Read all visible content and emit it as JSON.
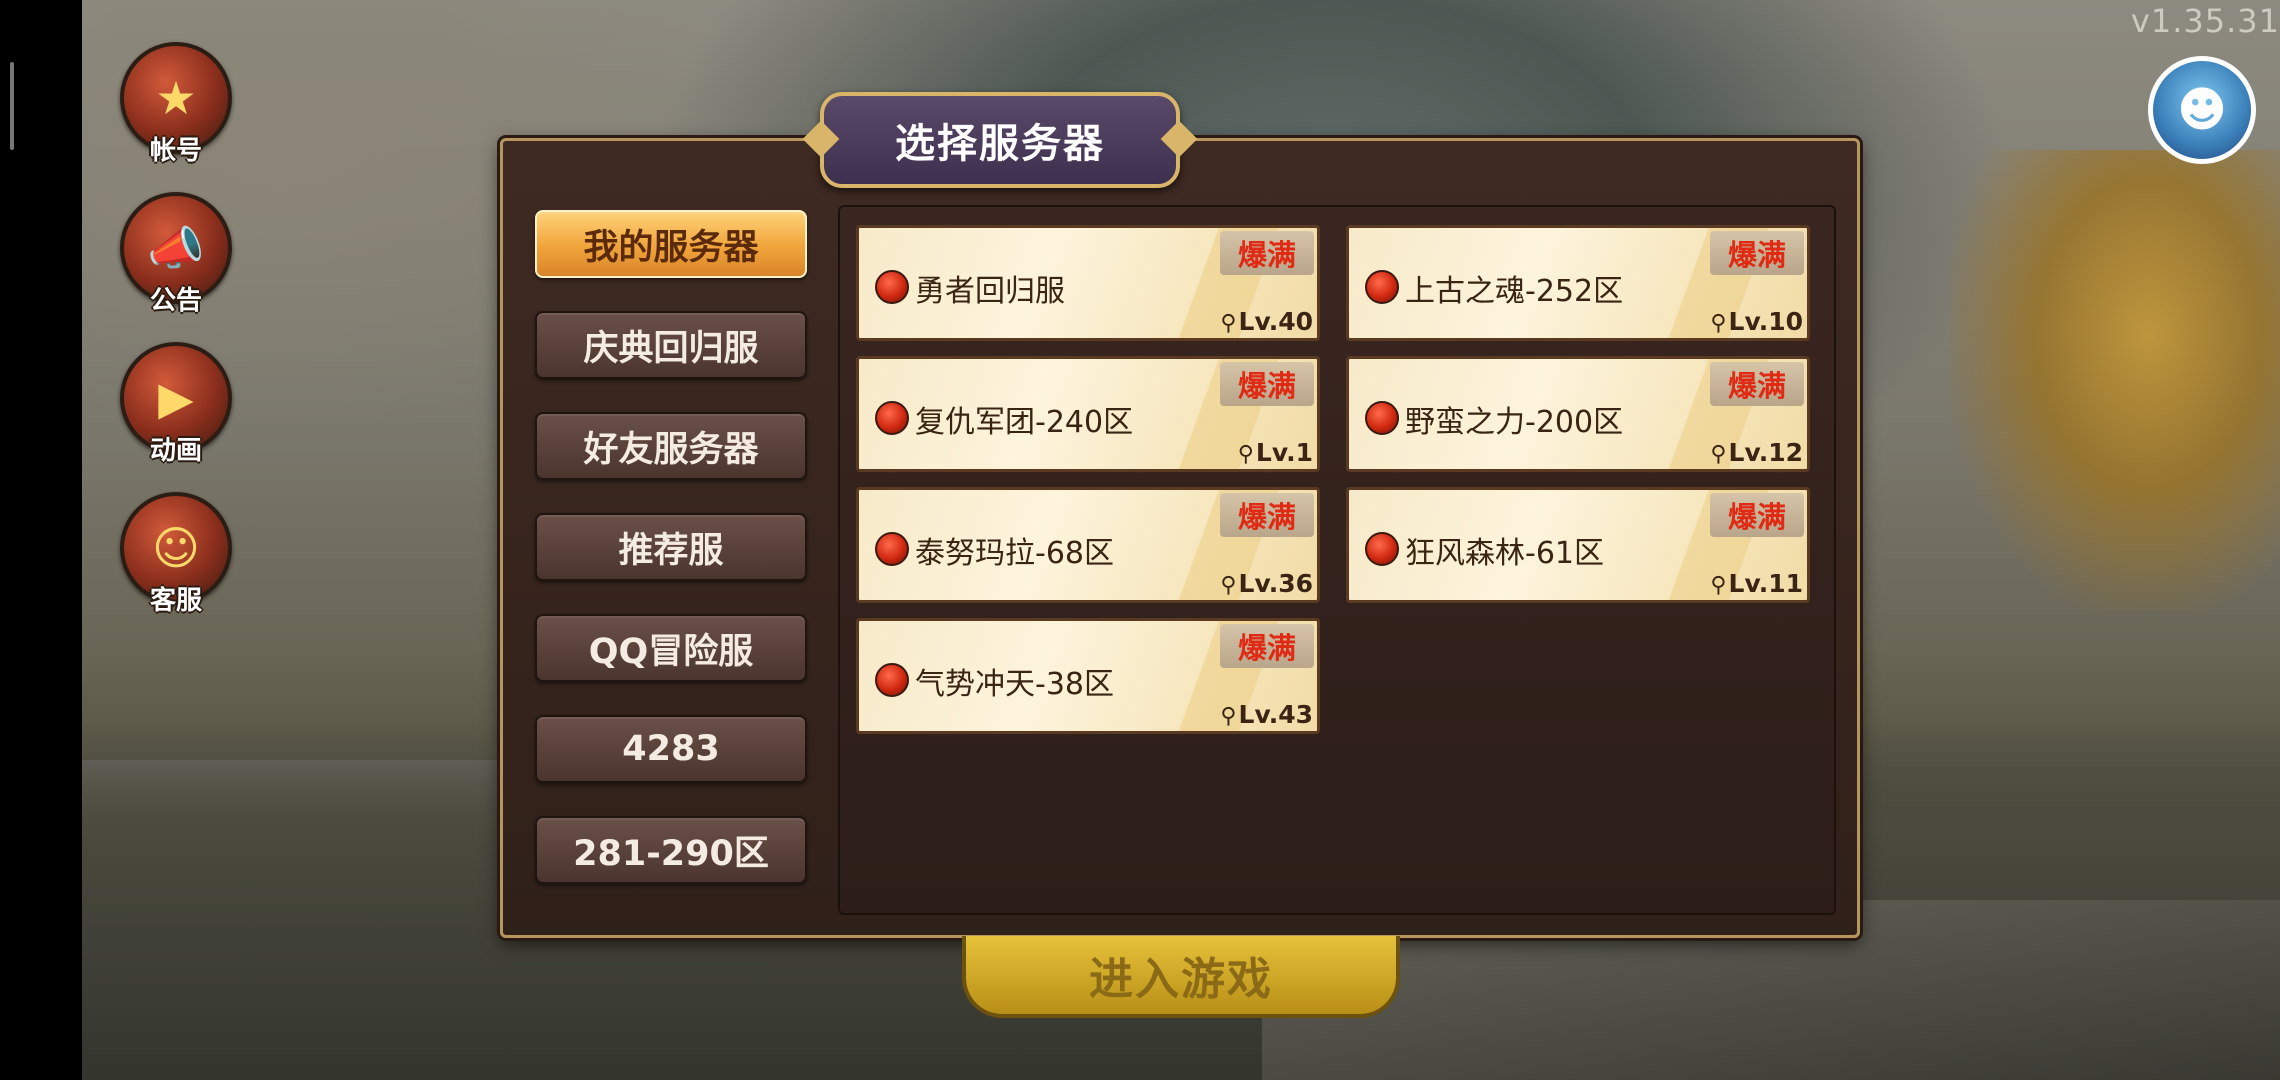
{
  "version": "v1.35.31",
  "side_buttons": [
    {
      "label": "帐号",
      "icon": "book-icon"
    },
    {
      "label": "公告",
      "icon": "megaphone-icon"
    },
    {
      "label": "动画",
      "icon": "video-icon"
    },
    {
      "label": "客服",
      "icon": "customer-service-icon"
    }
  ],
  "dialog": {
    "title": "选择服务器",
    "tabs": [
      {
        "label": "我的服务器",
        "active": true
      },
      {
        "label": "庆典回归服",
        "active": false
      },
      {
        "label": "好友服务器",
        "active": false
      },
      {
        "label": "推荐服",
        "active": false
      },
      {
        "label": "QQ冒险服",
        "active": false
      },
      {
        "label": "4283",
        "active": false
      },
      {
        "label": "281-290区",
        "active": false
      }
    ],
    "servers": [
      {
        "name": "勇者回归服",
        "status": "爆满",
        "level": "Lv.40"
      },
      {
        "name": "上古之魂-252区",
        "status": "爆满",
        "level": "Lv.10"
      },
      {
        "name": "复仇军团-240区",
        "status": "爆满",
        "level": "Lv.1"
      },
      {
        "name": "野蛮之力-200区",
        "status": "爆满",
        "level": "Lv.12"
      },
      {
        "name": "泰努玛拉-68区",
        "status": "爆满",
        "level": "Lv.36"
      },
      {
        "name": "狂风森林-61区",
        "status": "爆满",
        "level": "Lv.11"
      },
      {
        "name": "气势冲天-38区",
        "status": "爆满",
        "level": "Lv.43"
      }
    ],
    "enter_button": "进入游戏"
  },
  "colors": {
    "status_red": "#e02a14",
    "tab_active": "#f0a43a",
    "frame_gold": "#d9b56a"
  }
}
